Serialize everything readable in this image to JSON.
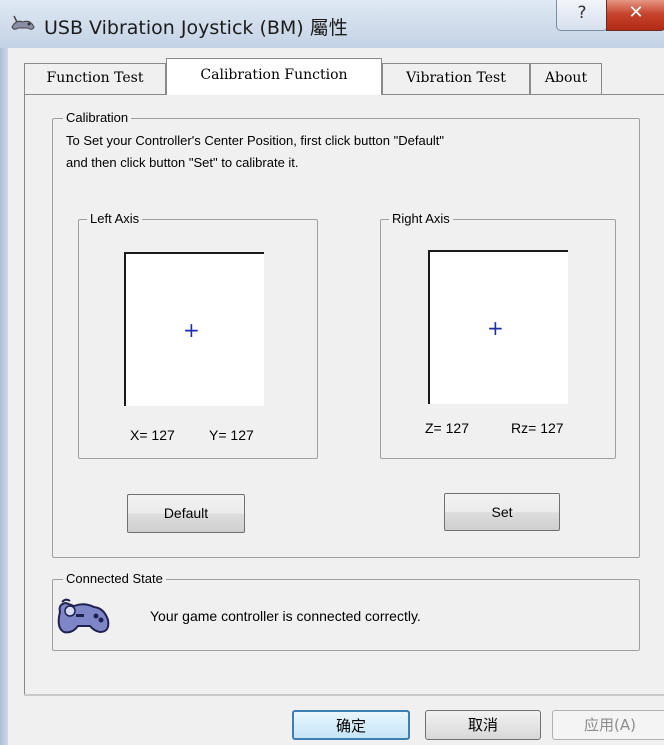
{
  "window": {
    "title": "USB Vibration Joystick (BM) 屬性",
    "help_label": "?",
    "close_label": "✕",
    "app_icon": "joystick-icon"
  },
  "tabs": [
    {
      "label": "Function Test",
      "active": false
    },
    {
      "label": "Calibration Function",
      "active": true
    },
    {
      "label": "Vibration Test",
      "active": false
    },
    {
      "label": "About",
      "active": false
    }
  ],
  "calibration": {
    "group_label": "Calibration",
    "description_line1": "To Set your Controller's  Center Position, first click button \"Default\"",
    "description_line2": "and then click button \"Set\" to calibrate it.",
    "left_axis": {
      "label": "Left Axis",
      "crosshair": "+",
      "x_label": "X=",
      "x_value": "127",
      "y_label": "Y=",
      "y_value": "127"
    },
    "right_axis": {
      "label": "Right Axis",
      "crosshair": "+",
      "z_label": "Z=",
      "z_value": "127",
      "rz_label": "Rz=",
      "rz_value": "127"
    },
    "default_button": "Default",
    "set_button": "Set"
  },
  "connected_state": {
    "group_label": "Connected State",
    "status_text": "Your game controller is connected correctly.",
    "icon": "gamepad-icon"
  },
  "footer": {
    "ok_button": "确定",
    "cancel_button": "取消",
    "apply_button": "应用(A)"
  },
  "colors": {
    "crosshair": "#1c2fa8",
    "title_bar": "#cfdbea",
    "close_button": "#c7432c",
    "focused_button_border": "#3c7fb1"
  }
}
